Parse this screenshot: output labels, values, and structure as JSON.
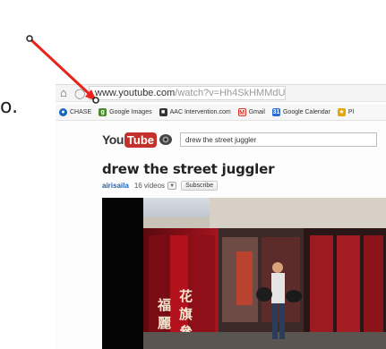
{
  "slide": {
    "fragment_text": "o."
  },
  "browser": {
    "url_host": "www.youtube.com",
    "url_path": "/watch?v=Hh4SkHMMdU",
    "bookmarks": [
      {
        "label": "CHASE",
        "icon": "chase-icon",
        "color": "#1a66b8"
      },
      {
        "label": "Google Images",
        "icon": "google-images-icon",
        "color": "#4a8a2c"
      },
      {
        "label": "AAC Intervention.com",
        "icon": "aac-icon",
        "color": "#333333"
      },
      {
        "label": "Gmail",
        "icon": "gmail-icon",
        "color": "#d93025"
      },
      {
        "label": "Google Calendar",
        "icon": "calendar-icon",
        "color": "#2a6bd1"
      },
      {
        "label": "Pl",
        "icon": "bookmark-icon",
        "color": "#e8a400"
      }
    ]
  },
  "youtube": {
    "logo_you": "You",
    "logo_tube": "Tube",
    "search_value": "drew the street juggler",
    "video_title": "drew the street juggler",
    "channel_name": "airisaila",
    "video_count": "16 videos",
    "subscribe_label": "Subscribe",
    "accent_color": "#c4302b"
  },
  "annotation": {
    "color": "#e8231c"
  }
}
